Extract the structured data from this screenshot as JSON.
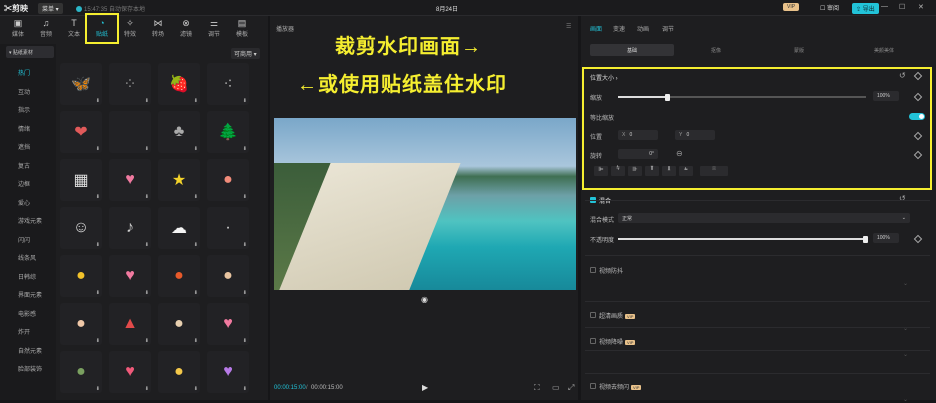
{
  "titlebar": {
    "logo": "✂剪映",
    "menu": "菜单 ▾",
    "save_status": "15:47:35 自动保存本地",
    "title": "8月24日",
    "vip": "VIP",
    "share": "☐ 审阅",
    "export": "⇪ 导出",
    "min": "—",
    "max": "☐",
    "close": "✕"
  },
  "toolbar": [
    {
      "icon": "▣",
      "label": "媒体"
    },
    {
      "icon": "♫",
      "label": "音频"
    },
    {
      "icon": "T",
      "label": "文本"
    },
    {
      "icon": "◔",
      "label": "贴纸"
    },
    {
      "icon": "✧",
      "label": "特效"
    },
    {
      "icon": "⋈",
      "label": "转场"
    },
    {
      "icon": "⊗",
      "label": "滤镜"
    },
    {
      "icon": "⚌",
      "label": "调节"
    },
    {
      "icon": "▤",
      "label": "模板"
    }
  ],
  "sticker_panel": {
    "collection": "▾ 贴纸素材",
    "filter": "可商用 ▾"
  },
  "categories": [
    "热门",
    "互动",
    "指示",
    "情绪",
    "遮挡",
    "复古",
    "边框",
    "爱心",
    "游戏元素",
    "闪闪",
    "线条风",
    "日韩综",
    "界面元素",
    "电影感",
    "炸开",
    "自然元素",
    "脸部装饰"
  ],
  "stickers": [
    {
      "icon": "🦋",
      "color": "#f2f2f2"
    },
    {
      "icon": "⁘",
      "color": "#888"
    },
    {
      "icon": "🍓",
      "color": "#e24a4a"
    },
    {
      "icon": "⁖",
      "color": "#aaa"
    },
    {
      "icon": "❤",
      "color": "#e15a5a"
    },
    {
      "icon": "",
      "color": "#888"
    },
    {
      "icon": "♣",
      "color": "#aaa"
    },
    {
      "icon": "🌲",
      "color": "#3e9b46"
    },
    {
      "icon": "▦",
      "color": "#ddd"
    },
    {
      "icon": "♥",
      "color": "#f07aa0"
    },
    {
      "icon": "★",
      "color": "#f2d22a"
    },
    {
      "icon": "●",
      "color": "#f28c7a"
    },
    {
      "icon": "☺",
      "color": "#ddd"
    },
    {
      "icon": "♪",
      "color": "#ccc"
    },
    {
      "icon": "☁",
      "color": "#f4f4f4"
    },
    {
      "icon": "·",
      "color": "#ddd"
    },
    {
      "icon": "●",
      "color": "#f2c22a"
    },
    {
      "icon": "♥",
      "color": "#f27aa0"
    },
    {
      "icon": "●",
      "color": "#e85a2a"
    },
    {
      "icon": "●",
      "color": "#e8c4a0"
    },
    {
      "icon": "●",
      "color": "#f0c8a8"
    },
    {
      "icon": "▲",
      "color": "#e24a4a"
    },
    {
      "icon": "●",
      "color": "#e8d0b0"
    },
    {
      "icon": "♥",
      "color": "#f27aa0"
    },
    {
      "icon": "●",
      "color": "#7aa060"
    },
    {
      "icon": "♥",
      "color": "#f05a7a"
    },
    {
      "icon": "●",
      "color": "#f4c84a"
    },
    {
      "icon": "♥",
      "color": "#b87ae8"
    }
  ],
  "download_glyph": "⬇",
  "player": {
    "label": "播放器",
    "time_current": "00:00:15:00",
    "time_total": "00:00:15:00",
    "play": "▶"
  },
  "overlay": {
    "line1": "裁剪水印画面→",
    "line2": "←或使用贴纸盖住水印"
  },
  "props": {
    "tabs": [
      {
        "label": "画面",
        "selected": true
      },
      {
        "label": "变速",
        "selected": false
      },
      {
        "label": "动画",
        "selected": false
      },
      {
        "label": "调节",
        "selected": false
      }
    ],
    "subtabs": [
      {
        "label": "基础",
        "selected": true
      },
      {
        "label": "抠像",
        "selected": false
      },
      {
        "label": "蒙版",
        "selected": false
      },
      {
        "label": "美颜美体",
        "selected": false
      }
    ],
    "position_size": "位置大小 ›",
    "scale": {
      "label": "缩放",
      "value": "100%",
      "fraction": 1.0
    },
    "uniform": "等比缩放",
    "position": {
      "label": "位置",
      "x_label": "X",
      "x": "0",
      "y_label": "Y",
      "y": "0"
    },
    "rotation": {
      "label": "旋转",
      "value": "0°"
    },
    "blend": {
      "label": "混合",
      "mode_label": "混合模式",
      "mode_value": "正常",
      "opacity_label": "不透明度",
      "opacity_value": "100%",
      "opacity_fraction": 1.0
    },
    "sections": [
      {
        "label": "视频防抖",
        "vip": false
      },
      {
        "label": "超清画质",
        "vip": true
      },
      {
        "label": "视频降噪",
        "vip": true
      },
      {
        "label": "视频去频闪",
        "vip": true
      }
    ]
  }
}
